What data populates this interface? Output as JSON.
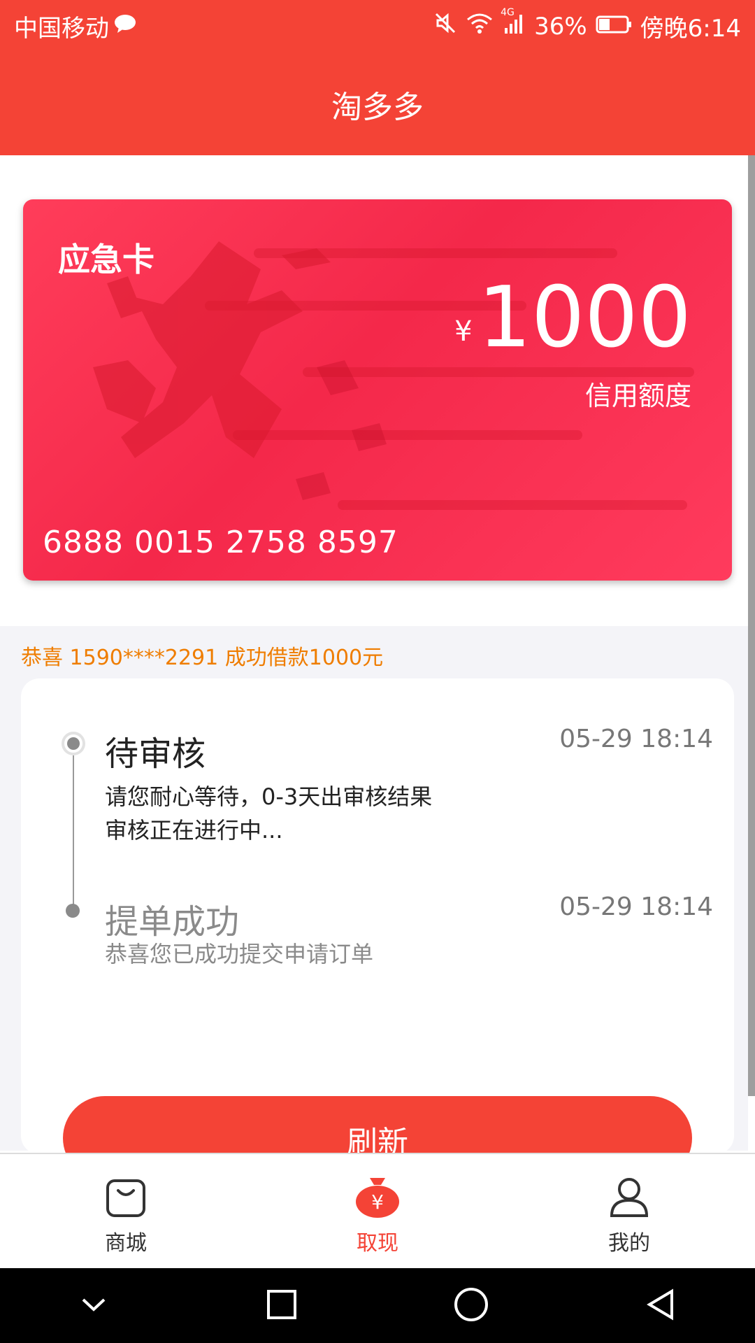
{
  "status_bar": {
    "carrier": "中国移动",
    "network": "4G",
    "battery": "36%",
    "time": "傍晚6:14"
  },
  "header": {
    "title": "淘多多"
  },
  "card": {
    "title": "应急卡",
    "currency": "¥",
    "amount": "1000",
    "amount_label": "信用额度",
    "number": "6888 0015 2758 8597"
  },
  "notice": "恭喜 1590****2291 成功借款1000元",
  "timeline": [
    {
      "title": "待审核",
      "time": "05-29  18:14",
      "desc1": "请您耐心等待，0-3天出审核结果",
      "desc2": "审核正在进行中..."
    },
    {
      "title": "提单成功",
      "time": "05-29 18:14",
      "desc1": "恭喜您已成功提交申请订单"
    }
  ],
  "refresh_label": "刷新",
  "bottom_nav": [
    {
      "label": "商城",
      "icon": "shopping-bag-icon"
    },
    {
      "label": "取现",
      "icon": "money-bag-icon",
      "active": true
    },
    {
      "label": "我的",
      "icon": "user-icon"
    }
  ],
  "colors": {
    "primary": "#f44336",
    "card": "#f4284a",
    "notice": "#ef7d00"
  }
}
